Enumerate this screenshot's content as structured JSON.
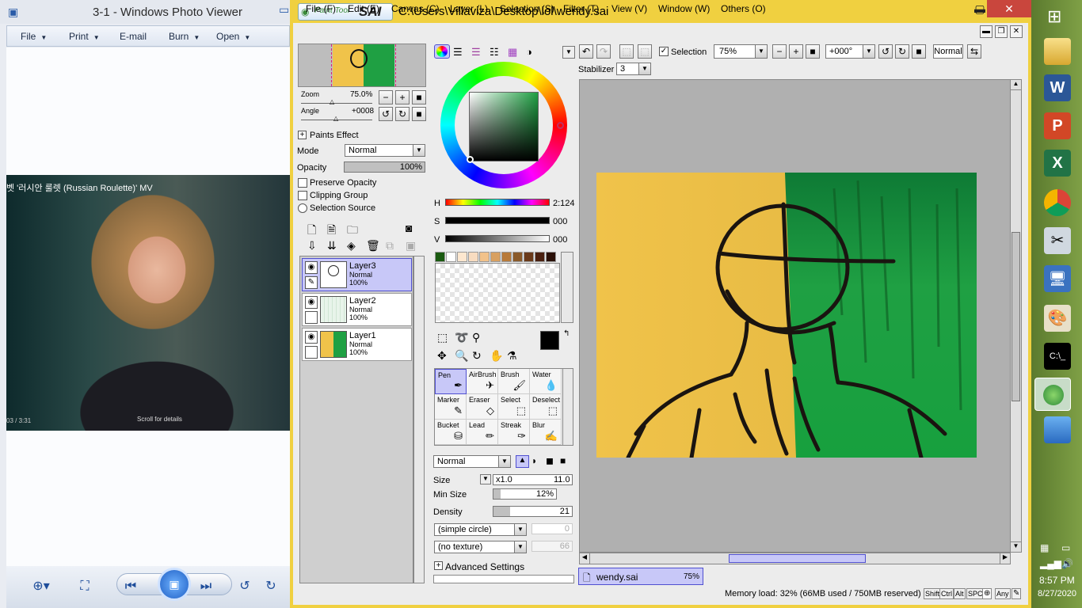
{
  "photo_viewer": {
    "title": "3-1 - Windows Photo Viewer",
    "menu": [
      "File",
      "Print",
      "E-mail",
      "Burn",
      "Open"
    ],
    "caption": "벳 '러시안 룰렛 (Russian Roulette)' MV",
    "time": "03 / 3:31",
    "scroll_hint": "Scroll for details"
  },
  "sai": {
    "logo_small": "Paint Tool",
    "logo_big": "SAI",
    "path": "C:\\Users\\Villaviza\\Desktop\\lol\\wendy.sai",
    "menu": [
      "File (F)",
      "Edit (E)",
      "Canvas (C)",
      "Layer (L)",
      "Selection (S)",
      "Filter (T)",
      "View (V)",
      "Window (W)",
      "Others (O)"
    ],
    "nav": {
      "zoom_label": "Zoom",
      "zoom_value": "75.0%",
      "angle_label": "Angle",
      "angle_value": "+0008"
    },
    "paints_effect": "Paints Effect",
    "mode_label": "Mode",
    "mode_value": "Normal",
    "opacity_label": "Opacity",
    "opacity_value": "100%",
    "opacity_fraction": 1.0,
    "checks": {
      "preserve": "Preserve Opacity",
      "clipping": "Clipping Group",
      "selection_source": "Selection Source"
    },
    "layers": [
      {
        "name": "Layer3",
        "mode": "Normal",
        "opacity": "100%",
        "selected": true
      },
      {
        "name": "Layer2",
        "mode": "Normal",
        "opacity": "100%",
        "selected": false
      },
      {
        "name": "Layer1",
        "mode": "Normal",
        "opacity": "100%",
        "selected": false
      }
    ],
    "hsv": {
      "h_label": "H",
      "h_value": "2:124",
      "s_label": "S",
      "s_value": "000",
      "v_label": "V",
      "v_value": "000"
    },
    "tools": [
      {
        "name": "Pen",
        "icon": "✒",
        "selected": true
      },
      {
        "name": "AirBrush",
        "icon": "✈",
        "selected": false
      },
      {
        "name": "Brush",
        "icon": "🖌",
        "selected": false
      },
      {
        "name": "Water",
        "icon": "💧",
        "selected": false
      },
      {
        "name": "Marker",
        "icon": "✎",
        "selected": false
      },
      {
        "name": "Eraser",
        "icon": "◇",
        "selected": false
      },
      {
        "name": "Select",
        "icon": "⬚",
        "selected": false
      },
      {
        "name": "Deselect",
        "icon": "⬚",
        "selected": false
      },
      {
        "name": "Bucket",
        "icon": "⛁",
        "selected": false
      },
      {
        "name": "Lead",
        "icon": "✏",
        "selected": false
      },
      {
        "name": "Streak",
        "icon": "✑",
        "selected": false
      },
      {
        "name": "Blur",
        "icon": "✍",
        "selected": false
      }
    ],
    "brush": {
      "blend": "Normal",
      "size_label": "Size",
      "size_mult": "x1.0",
      "size_value": "11.0",
      "minsize_label": "Min Size",
      "minsize_value": "12%",
      "minsize_fraction": 0.12,
      "density_label": "Density",
      "density_value": "21",
      "density_fraction": 0.21,
      "shape": "(simple circle)",
      "shape_value": "0",
      "texture": "(no texture)",
      "texture_value": "66",
      "advanced": "Advanced Settings"
    },
    "toolbar": {
      "selection_label": "Selection",
      "zoom": "75%",
      "rotation": "+000°",
      "blend": "Normal",
      "stabilizer_label": "Stabilizer",
      "stabilizer_value": "3"
    },
    "doc_tab": {
      "name": "wendy.sai",
      "zoom": "75%"
    },
    "status": "Memory load: 32% (66MB used / 750MB reserved)",
    "keys": [
      "Shift",
      "Ctrl",
      "Alt",
      "SPC",
      "Any"
    ],
    "swatch_colors": [
      "#1a5a10",
      "#ffffff",
      "#fde7cf",
      "#f8dcc0",
      "#f2c28a",
      "#d8a060",
      "#b87a3a",
      "#8a5a2a",
      "#6a3a1a",
      "#4a2010",
      "#2a1008"
    ]
  },
  "taskbar": {
    "time": "8:57 PM",
    "date": "8/27/2020"
  }
}
